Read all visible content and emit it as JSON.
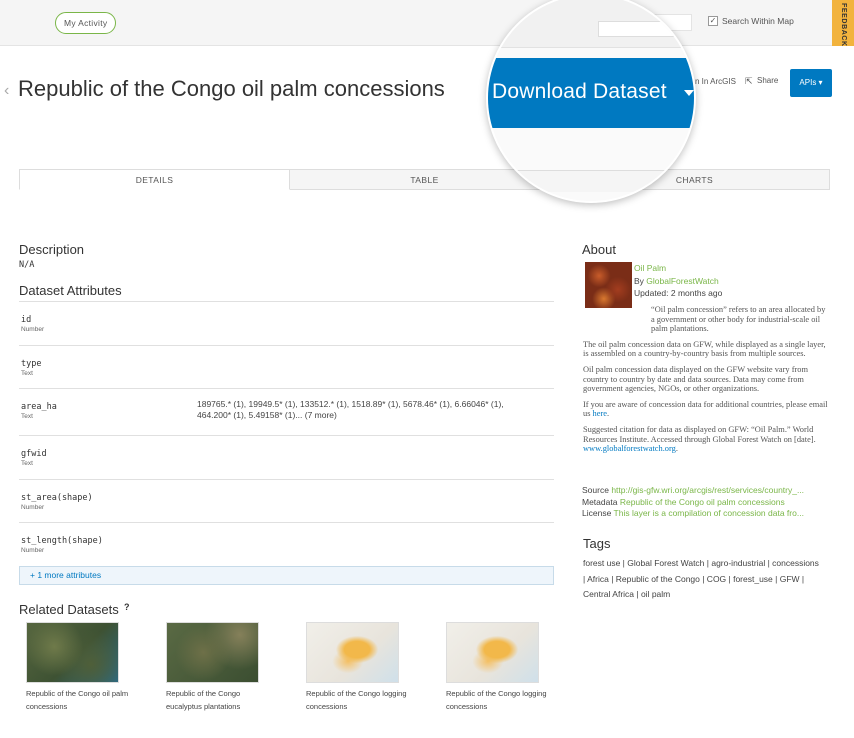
{
  "topbar": {
    "my_activity": "My Activity",
    "search_within_map": "Search Within Map",
    "search_within_checked": true,
    "feedback": "FEEDBACK"
  },
  "header": {
    "title": "Republic of the Congo oil palm concessions",
    "open_in_arcgis": "n In ArcGIS",
    "share": "Share",
    "apis": "APIs"
  },
  "magnifier": {
    "download_label": "Download Dataset"
  },
  "tabs": [
    {
      "label": "DETAILS",
      "active": true
    },
    {
      "label": "TABLE",
      "active": false
    },
    {
      "label": "CHARTS",
      "active": false
    }
  ],
  "description": {
    "heading": "Description",
    "value": "N/A"
  },
  "attributes": {
    "heading": "Dataset Attributes",
    "rows": [
      {
        "name": "id",
        "type": "Number",
        "values": ""
      },
      {
        "name": "type",
        "type": "Text",
        "values": ""
      },
      {
        "name": "area_ha",
        "type": "Text",
        "values": "189765.* (1), 19949.5* (1), 133512.* (1), 1518.89* (1), 5678.46* (1), 6.66046* (1), 464.200* (1), 5.49158* (1)... (7 more)"
      },
      {
        "name": "gfwid",
        "type": "Text",
        "values": ""
      },
      {
        "name": "st_area(shape)",
        "type": "Number",
        "values": ""
      },
      {
        "name": "st_length(shape)",
        "type": "Number",
        "values": ""
      }
    ],
    "more": "+ 1 more attributes"
  },
  "related": {
    "heading": "Related Datasets",
    "help": "?",
    "items": [
      {
        "caption": "Republic of the Congo oil palm concessions"
      },
      {
        "caption": "Republic of the Congo eucalyptus plantations"
      },
      {
        "caption": "Republic of the Congo logging concessions"
      },
      {
        "caption": "Republic of the Congo logging concessions"
      }
    ]
  },
  "about": {
    "heading": "About",
    "name": "Oil Palm",
    "by_prefix": "By ",
    "by_org": "GlobalForestWatch",
    "updated": "Updated: 2 months ago",
    "p1": "“Oil palm concession” refers to an area allocated by a government or other body for industrial-scale oil palm plantations.",
    "p2": "The oil palm concession data on GFW, while displayed as a single layer, is assembled on a country-by-country basis from multiple sources.",
    "p3": "Oil palm concession data displayed on the GFW website vary from country to country by date and data sources. Data may come from government agencies, NGOs, or other organizations.",
    "p4_prefix": "If you are aware of concession data for additional countries, please email us ",
    "p4_link": "here",
    "p4_suffix": ".",
    "p5": "Suggested citation for data as displayed on GFW: “Oil Palm.” World Resources Institute. Accessed through Global Forest Watch on [date]. ",
    "p5_link": "www.globalforestwatch.org",
    "p5_suffix": ".",
    "source_label": "Source",
    "source_value": "http://gis-gfw.wri.org/arcgis/rest/services/country_...",
    "metadata_label": "Metadata",
    "metadata_value": "Republic of the Congo oil palm concessions",
    "license_label": "License",
    "license_value": "This layer is a compilation of concession data fro..."
  },
  "tags": {
    "heading": "Tags",
    "text": "forest use | Global Forest Watch | agro-industrial | concessions | Africa | Republic of the Congo | COG | forest_use | GFW | Central Africa | oil palm"
  },
  "colors": {
    "accent_blue": "#0079c1",
    "accent_green": "#7ab648",
    "feedback_orange": "#f2b33d"
  }
}
